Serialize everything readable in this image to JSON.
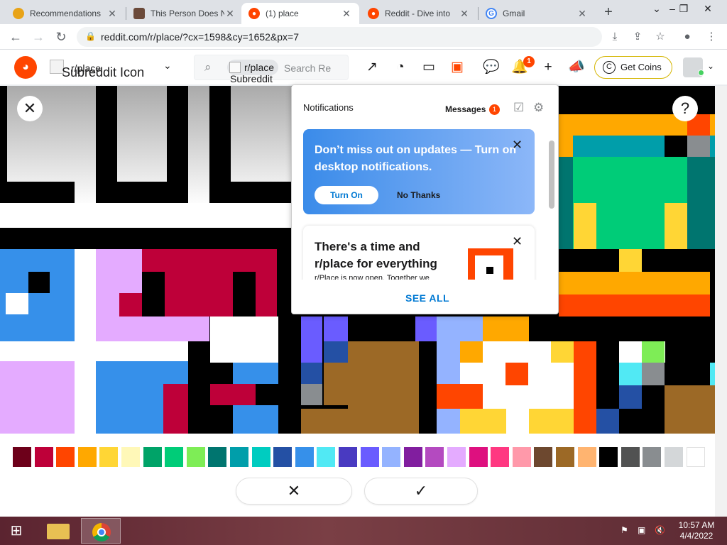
{
  "browser": {
    "tabs": [
      {
        "title": "Recommendations",
        "favicon_color": "#e8a317",
        "active": false
      },
      {
        "title": "This Person Does N",
        "favicon_color": "#6b4a3a",
        "active": false
      },
      {
        "title": "(1) place",
        "favicon_color": "#ff4500",
        "active": true
      },
      {
        "title": "Reddit - Dive into",
        "favicon_color": "#ff4500",
        "active": false
      },
      {
        "title": "Gmail",
        "favicon_color": "#4285f4",
        "active": false
      }
    ],
    "url": "reddit.com/r/place/?cx=1598&cy=1652&px=7"
  },
  "reddit_header": {
    "subreddit": "r/place",
    "subreddit_alt": "Subreddit Icon",
    "search_chip": "r/place",
    "search_placeholder": "Search Re",
    "search_chip_alt": "Subreddit Icon",
    "notif_count": "1",
    "get_coins": "Get Coins"
  },
  "notifications": {
    "title": "Notifications",
    "messages_label": "Messages",
    "messages_count": "1",
    "card1": {
      "heading": "Don’t miss out on updates — Turn on desktop notifications.",
      "turn_on": "Turn On",
      "no_thanks": "No Thanks"
    },
    "card2": {
      "heading": "There's a time and r/place for everything",
      "body": "r/Place is now open. Together we"
    },
    "see_all": "SEE ALL"
  },
  "palette": {
    "colors": [
      "#6d001a",
      "#be0039",
      "#ff4500",
      "#ffa800",
      "#ffd635",
      "#fff8b8",
      "#00a368",
      "#00cc78",
      "#7eed56",
      "#00756f",
      "#009eaa",
      "#00ccc0",
      "#2450a4",
      "#3690ea",
      "#51e9f4",
      "#493ac1",
      "#6a5cff",
      "#94b3ff",
      "#811e9f",
      "#b44ac0",
      "#e4abff",
      "#de107f",
      "#ff3881",
      "#ff99aa",
      "#6d482f",
      "#9c6926",
      "#ffb470",
      "#000000",
      "#515252",
      "#898d90",
      "#d4d7d9",
      "#ffffff"
    ],
    "cancel_icon": "close-icon",
    "confirm_icon": "checkmark-icon"
  },
  "taskbar": {
    "time": "10:57 AM",
    "date": "4/4/2022"
  }
}
